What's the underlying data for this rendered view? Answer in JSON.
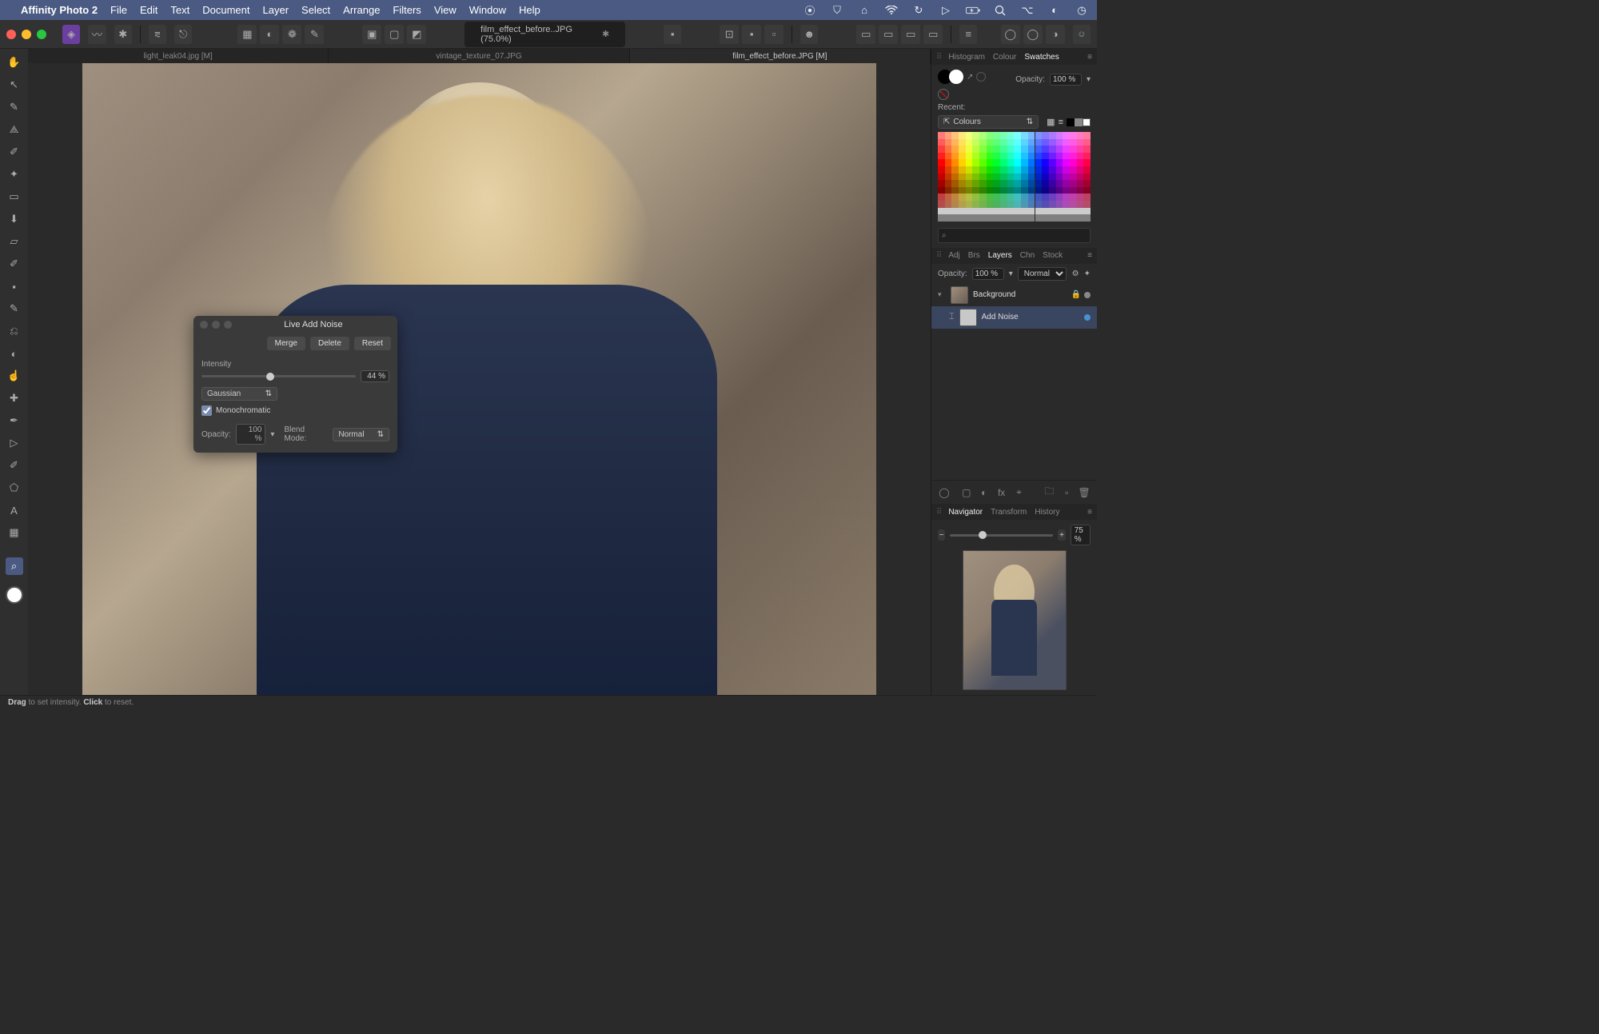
{
  "menubar": {
    "app_name": "Affinity Photo 2",
    "items": [
      "File",
      "Edit",
      "Text",
      "Document",
      "Layer",
      "Select",
      "Arrange",
      "Filters",
      "View",
      "Window",
      "Help"
    ]
  },
  "toolbar": {
    "doc_title": "film_effect_before..JPG (75.0%)"
  },
  "doc_tabs": [
    {
      "label": "light_leak04.jpg [M]",
      "active": false
    },
    {
      "label": "vintage_texture_07.JPG",
      "active": false
    },
    {
      "label": "film_effect_before.JPG [M]",
      "active": true
    }
  ],
  "dialog": {
    "title": "Live Add Noise",
    "merge": "Merge",
    "delete": "Delete",
    "reset": "Reset",
    "intensity_label": "Intensity",
    "intensity_value": "44 %",
    "distribution": "Gaussian",
    "mono_label": "Monochromatic",
    "opacity_label": "Opacity:",
    "opacity_value": "100 %",
    "blend_label": "Blend Mode:",
    "blend_value": "Normal"
  },
  "swatches": {
    "tab_histogram": "Histogram",
    "tab_colour": "Colour",
    "tab_swatches": "Swatches",
    "opacity_label": "Opacity:",
    "opacity_value": "100 %",
    "recent_label": "Recent:",
    "colours_label": "Colours"
  },
  "layers": {
    "tab_adj": "Adj",
    "tab_brs": "Brs",
    "tab_layers": "Layers",
    "tab_chn": "Chn",
    "tab_stock": "Stock",
    "opacity_label": "Opacity:",
    "opacity_value": "100 %",
    "blend": "Normal",
    "items": [
      {
        "name": "Background",
        "locked": true
      },
      {
        "name": "Add Noise",
        "locked": false
      }
    ]
  },
  "navigator": {
    "tab_nav": "Navigator",
    "tab_transform": "Transform",
    "tab_history": "History",
    "zoom": "75 %"
  },
  "statusbar": {
    "drag": "Drag",
    "drag_rest": " to set intensity. ",
    "click": "Click",
    "click_rest": " to reset."
  }
}
